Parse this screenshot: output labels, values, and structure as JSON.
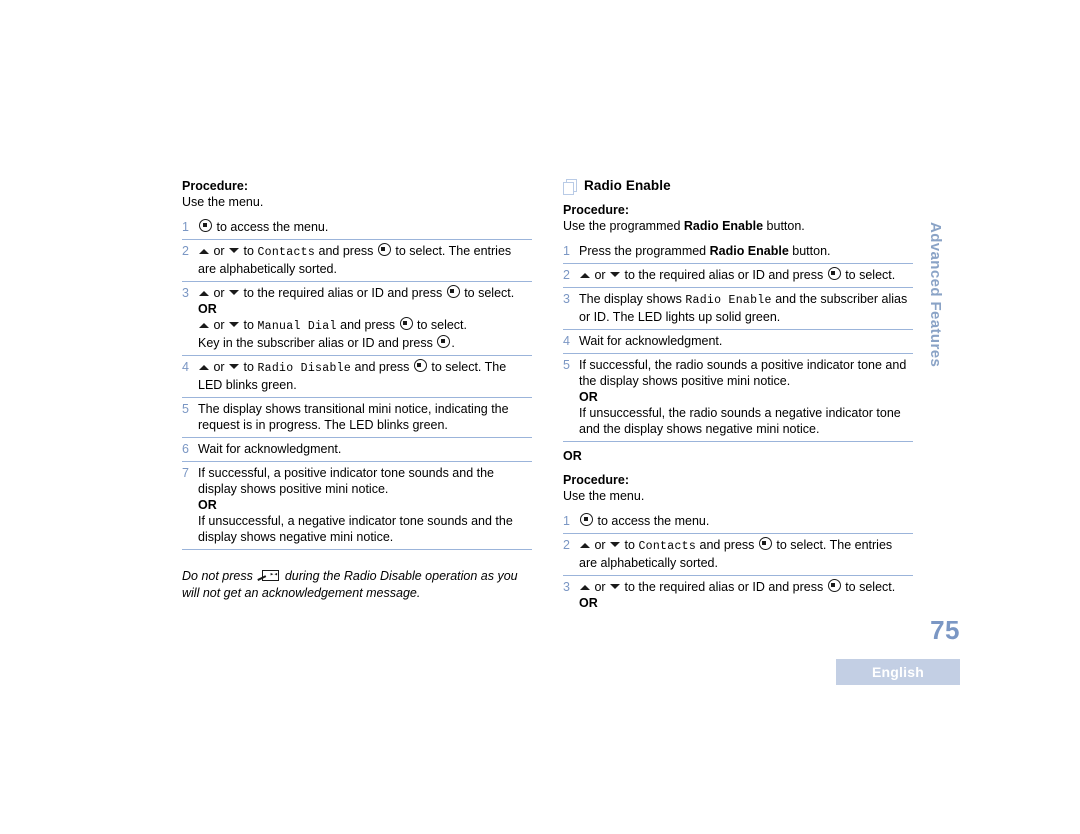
{
  "document": {
    "page_number": "75",
    "language_badge": "English",
    "side_tab": "Advanced Features"
  },
  "left_column": {
    "procedure_label": "Procedure:",
    "procedure_sub": "Use the menu.",
    "steps": [
      {
        "num": "1",
        "lines": [
          {
            "parts": [
              {
                "t": "key",
                "v": "menu-key"
              },
              {
                "t": "text",
                "v": " to access the menu."
              }
            ]
          }
        ]
      },
      {
        "num": "2",
        "lines": [
          {
            "parts": [
              {
                "t": "arrow-up",
                "v": "arrow-up"
              },
              {
                "t": "text",
                "v": " or "
              },
              {
                "t": "arrow-down",
                "v": "arrow-down"
              },
              {
                "t": "text",
                "v": " to "
              },
              {
                "t": "mono",
                "v": "Contacts"
              },
              {
                "t": "text",
                "v": " and press "
              },
              {
                "t": "key",
                "v": "menu-key"
              },
              {
                "t": "text",
                "v": " to select. The entries"
              }
            ]
          },
          {
            "parts": [
              {
                "t": "text",
                "v": "are alphabetically sorted."
              }
            ]
          }
        ]
      },
      {
        "num": "3",
        "lines": [
          {
            "parts": [
              {
                "t": "arrow-up",
                "v": "arrow-up"
              },
              {
                "t": "text",
                "v": " or "
              },
              {
                "t": "arrow-down",
                "v": "arrow-down"
              },
              {
                "t": "text",
                "v": " to the required alias or ID and press "
              },
              {
                "t": "key",
                "v": "menu-key"
              },
              {
                "t": "text",
                "v": " to select."
              }
            ]
          },
          {
            "or": true,
            "parts": [
              {
                "t": "text",
                "v": "OR"
              }
            ]
          },
          {
            "parts": [
              {
                "t": "arrow-up",
                "v": "arrow-up"
              },
              {
                "t": "text",
                "v": " or "
              },
              {
                "t": "arrow-down",
                "v": "arrow-down"
              },
              {
                "t": "text",
                "v": " to "
              },
              {
                "t": "mono",
                "v": "Manual Dial"
              },
              {
                "t": "text",
                "v": " and press "
              },
              {
                "t": "key",
                "v": "menu-key"
              },
              {
                "t": "text",
                "v": " to select."
              }
            ]
          },
          {
            "parts": [
              {
                "t": "text",
                "v": "Key in the subscriber alias or ID and press "
              },
              {
                "t": "key",
                "v": "menu-key"
              },
              {
                "t": "text",
                "v": "."
              }
            ]
          }
        ]
      },
      {
        "num": "4",
        "lines": [
          {
            "parts": [
              {
                "t": "arrow-up",
                "v": "arrow-up"
              },
              {
                "t": "text",
                "v": " or "
              },
              {
                "t": "arrow-down",
                "v": "arrow-down"
              },
              {
                "t": "text",
                "v": " to "
              },
              {
                "t": "mono",
                "v": "Radio Disable"
              },
              {
                "t": "text",
                "v": " and press "
              },
              {
                "t": "key",
                "v": "menu-key"
              },
              {
                "t": "text",
                "v": " to select. The"
              }
            ]
          },
          {
            "parts": [
              {
                "t": "text",
                "v": "LED blinks green."
              }
            ]
          }
        ]
      },
      {
        "num": "5",
        "lines": [
          {
            "parts": [
              {
                "t": "text",
                "v": "The display shows transitional mini notice, indicating the"
              }
            ]
          },
          {
            "parts": [
              {
                "t": "text",
                "v": "request is in progress. The LED blinks green."
              }
            ]
          }
        ]
      },
      {
        "num": "6",
        "lines": [
          {
            "parts": [
              {
                "t": "text",
                "v": "Wait for acknowledgment."
              }
            ]
          }
        ]
      },
      {
        "num": "7",
        "lines": [
          {
            "parts": [
              {
                "t": "text",
                "v": "If successful, a positive indicator tone sounds and the"
              }
            ]
          },
          {
            "parts": [
              {
                "t": "text",
                "v": "display shows positive mini notice."
              }
            ]
          },
          {
            "or": true,
            "parts": [
              {
                "t": "text",
                "v": "OR"
              }
            ]
          },
          {
            "parts": [
              {
                "t": "text",
                "v": "If unsuccessful, a negative indicator tone sounds and the"
              }
            ]
          },
          {
            "parts": [
              {
                "t": "text",
                "v": "display shows negative mini notice."
              }
            ]
          }
        ]
      }
    ],
    "note": {
      "before": "Do not press ",
      "key": "back-key",
      "after": " during the Radio Disable operation as you will not get an acknowledgement message."
    }
  },
  "right_column": {
    "section_icon": "pages-icon",
    "section_title": "Radio Enable",
    "procedure_label": "Procedure:",
    "procedure_sub_parts": [
      {
        "t": "text",
        "v": "Use the programmed "
      },
      {
        "t": "bold",
        "v": "Radio Enable"
      },
      {
        "t": "text",
        "v": " button."
      }
    ],
    "steps_a": [
      {
        "num": "1",
        "lines": [
          {
            "parts": [
              {
                "t": "text",
                "v": "Press the programmed "
              },
              {
                "t": "bold",
                "v": "Radio Enable"
              },
              {
                "t": "text",
                "v": " button."
              }
            ]
          }
        ]
      },
      {
        "num": "2",
        "lines": [
          {
            "parts": [
              {
                "t": "arrow-up",
                "v": "arrow-up"
              },
              {
                "t": "text",
                "v": " or "
              },
              {
                "t": "arrow-down",
                "v": "arrow-down"
              },
              {
                "t": "text",
                "v": " to the required alias or ID and press "
              },
              {
                "t": "key",
                "v": "menu-key"
              },
              {
                "t": "text",
                "v": " to select."
              }
            ]
          }
        ]
      },
      {
        "num": "3",
        "lines": [
          {
            "parts": [
              {
                "t": "text",
                "v": " The display shows "
              },
              {
                "t": "mono",
                "v": "Radio Enable"
              },
              {
                "t": "text",
                "v": " and the subscriber alias"
              }
            ]
          },
          {
            "parts": [
              {
                "t": "text",
                "v": "or ID. The LED lights up solid green."
              }
            ]
          }
        ]
      },
      {
        "num": "4",
        "lines": [
          {
            "parts": [
              {
                "t": "text",
                "v": "Wait for acknowledgment."
              }
            ]
          }
        ]
      },
      {
        "num": "5",
        "lines": [
          {
            "parts": [
              {
                "t": "text",
                "v": "If successful, the radio sounds a positive indicator tone and"
              }
            ]
          },
          {
            "parts": [
              {
                "t": "text",
                "v": "the display shows positive mini notice."
              }
            ]
          },
          {
            "or": true,
            "parts": [
              {
                "t": "text",
                "v": "OR"
              }
            ]
          },
          {
            "parts": [
              {
                "t": "text",
                "v": "If unsuccessful, the radio sounds a negative indicator tone"
              }
            ]
          },
          {
            "parts": [
              {
                "t": "text",
                "v": "and the display shows negative mini notice."
              }
            ]
          }
        ]
      }
    ],
    "divider_or": "OR",
    "procedure_label_2": "Procedure:",
    "procedure_sub_2": "Use the menu.",
    "steps_b": [
      {
        "num": "1",
        "lines": [
          {
            "parts": [
              {
                "t": "key",
                "v": "menu-key"
              },
              {
                "t": "text",
                "v": " to access the menu."
              }
            ]
          }
        ]
      },
      {
        "num": "2",
        "lines": [
          {
            "parts": [
              {
                "t": "arrow-up",
                "v": "arrow-up"
              },
              {
                "t": "text",
                "v": " or "
              },
              {
                "t": "arrow-down",
                "v": "arrow-down"
              },
              {
                "t": "text",
                "v": " to "
              },
              {
                "t": "mono",
                "v": "Contacts"
              },
              {
                "t": "text",
                "v": " and press "
              },
              {
                "t": "key",
                "v": "menu-key"
              },
              {
                "t": "text",
                "v": " to select. The entries"
              }
            ]
          },
          {
            "parts": [
              {
                "t": "text",
                "v": "are alphabetically sorted."
              }
            ]
          }
        ]
      },
      {
        "num": "3",
        "no_rule": true,
        "lines": [
          {
            "parts": [
              {
                "t": "arrow-up",
                "v": "arrow-up"
              },
              {
                "t": "text",
                "v": " or "
              },
              {
                "t": "arrow-down",
                "v": "arrow-down"
              },
              {
                "t": "text",
                "v": " to the required alias or ID and press "
              },
              {
                "t": "key",
                "v": "menu-key"
              },
              {
                "t": "text",
                "v": " to select."
              }
            ]
          },
          {
            "or": true,
            "parts": [
              {
                "t": "text",
                "v": "OR"
              }
            ]
          }
        ]
      }
    ]
  }
}
